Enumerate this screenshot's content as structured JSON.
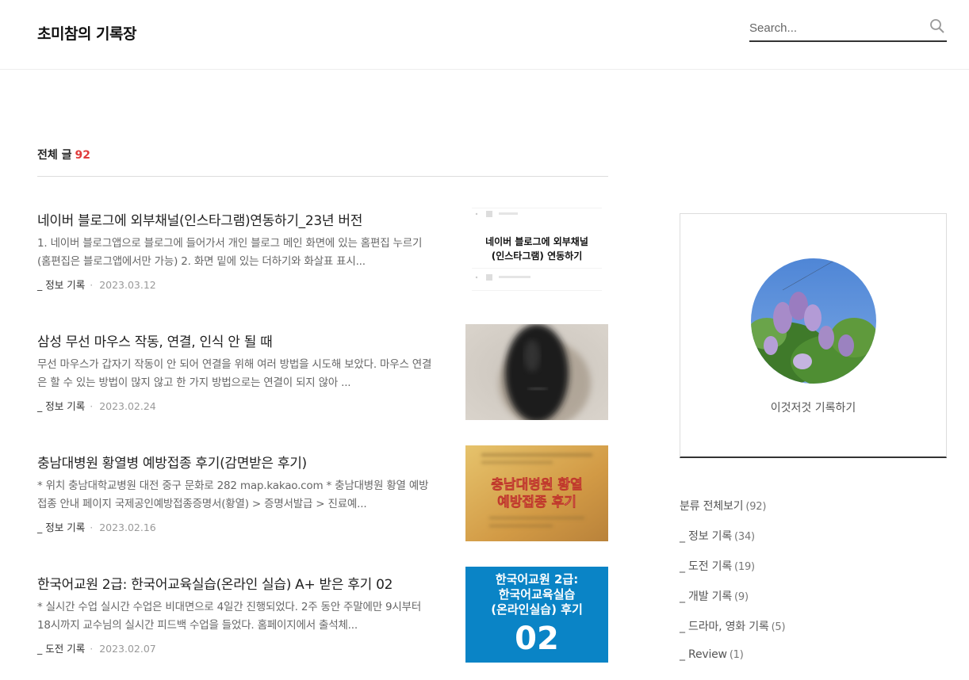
{
  "header": {
    "blog_title": "초미참의 기록장",
    "search_placeholder": "Search..."
  },
  "content_head": {
    "label": "전체 글",
    "count": "92"
  },
  "posts": [
    {
      "title": "네이버 블로그에 외부채널(인스타그램)연동하기_23년 버전",
      "excerpt": "1. 네이버 블로그앱으로 블로그에 들어가서 개인 블로그 메인 화면에 있는 홈편집 누르기 (홈편집은 블로그앱에서만 가능) 2. 화면 밑에 있는 더하기와 화살표 표시...",
      "category": "_ 정보 기록",
      "date": "2023.03.12",
      "thumb_text": [
        "네이버 블로그에 외부채널",
        "(인스타그램) 연동하기"
      ]
    },
    {
      "title": "삼성 무선 마우스 작동, 연결, 인식 안 될 때",
      "excerpt": "무선 마우스가 갑자기 작동이 안 되어 연결을 위해 여러 방법을 시도해 보았다. 마우스 연결은 할 수 있는 방법이 많지 않고 한 가지 방법으로는 연결이 되지 않아 ...",
      "category": "_ 정보 기록",
      "date": "2023.02.24"
    },
    {
      "title": "충남대병원 황열병 예방접종 후기(감면받은 후기)",
      "excerpt": "* 위치 충남대학교병원 대전 중구 문화로 282 map.kakao.com * 충남대병원 황열 예방접종 안내 페이지 국제공인예방접종증명서(황열) > 증명서발급 > 진료예...",
      "category": "_ 정보 기록",
      "date": "2023.02.16",
      "thumb_text": [
        "충남대병원 황열",
        "예방접종 후기"
      ]
    },
    {
      "title": "한국어교원 2급: 한국어교육실습(온라인 실습) A+ 받은 후기 02",
      "excerpt": "* 실시간 수업 실시간 수업은 비대면으로 4일간 진행되었다. 2주 동안 주말에만 9시부터 18시까지 교수님의 실시간 피드백 수업을 들었다. 홈페이지에서 출석체...",
      "category": "_ 도전 기록",
      "date": "2023.02.07",
      "thumb_text": [
        "한국어교원 2급:",
        "한국어교육실습",
        "(온라인실습) 후기",
        "02"
      ]
    }
  ],
  "profile": {
    "description": "이것저것 기록하기"
  },
  "categories": [
    {
      "label": "분류 전체보기",
      "count": "(92)"
    },
    {
      "label": "_ 정보 기록",
      "count": "(34)"
    },
    {
      "label": "_ 도전 기록",
      "count": "(19)"
    },
    {
      "label": "_ 개발 기록",
      "count": "(9)"
    },
    {
      "label": "_ 드라마, 영화 기록",
      "count": "(5)"
    },
    {
      "label": "_ Review",
      "count": "(1)"
    }
  ],
  "colors": {
    "accent_red": "#e03c3c",
    "thumb_blue": "#0a84c6",
    "thumb_orange": "#d9a24a"
  }
}
